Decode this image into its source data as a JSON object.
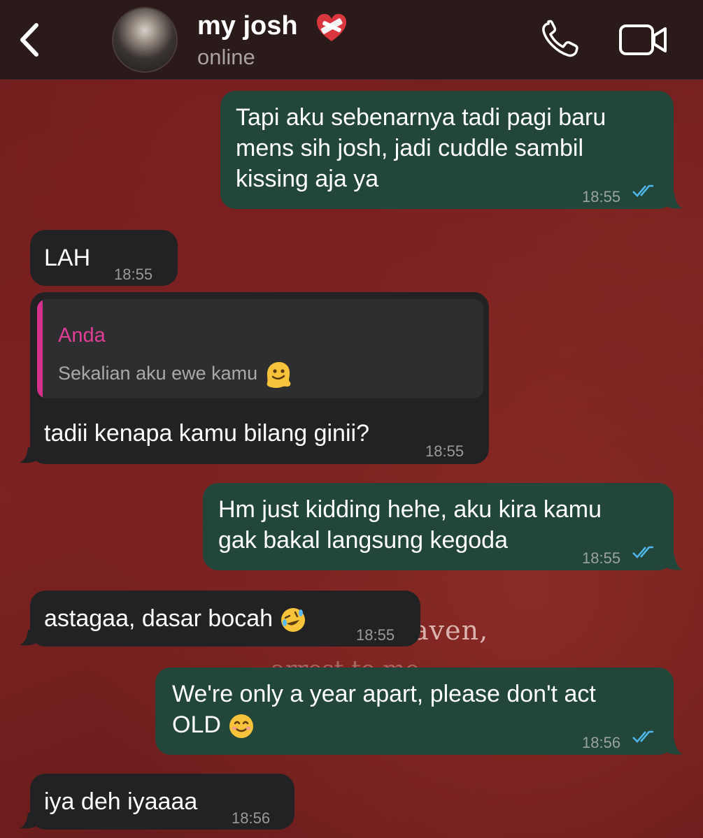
{
  "header": {
    "back_icon": "chevron-left-icon",
    "contact_name": "my josh",
    "name_emoji": "mending-heart-icon",
    "status": "online",
    "call_icon": "phone-icon",
    "video_icon": "video-camera-icon"
  },
  "wallpaper": {
    "text_line1": "aven,",
    "text_line2": "...arrest to me"
  },
  "messages": [
    {
      "direction": "outgoing",
      "lines": [
        "Tapi aku sebenarnya tadi pagi baru",
        "mens sih josh, jadi cuddle sambil",
        "kissing aja ya"
      ],
      "time": "18:55",
      "read": true
    },
    {
      "direction": "incoming",
      "lines": [
        "LAH"
      ],
      "time": "18:55"
    },
    {
      "direction": "incoming",
      "reply": {
        "author": "Anda",
        "text": "Sekalian aku ewe kamu",
        "emoji": "melting-face-icon"
      },
      "lines": [
        "tadii kenapa kamu bilang ginii?"
      ],
      "time": "18:55"
    },
    {
      "direction": "outgoing",
      "lines": [
        "Hm just kidding hehe, aku kira kamu",
        "gak bakal langsung kegoda"
      ],
      "time": "18:55",
      "read": true
    },
    {
      "direction": "incoming",
      "lines": [
        "astagaa, dasar bocah"
      ],
      "emoji": "rofl-face-icon",
      "time": "18:55"
    },
    {
      "direction": "outgoing",
      "lines": [
        "We're only a year apart, please don't act",
        "OLD"
      ],
      "emoji": "smiling-face-icon",
      "time": "18:56",
      "read": true
    },
    {
      "direction": "incoming",
      "lines": [
        "iya deh iyaaaa"
      ],
      "time": "18:56"
    }
  ],
  "colors": {
    "outgoing_bubble": "#22473a",
    "incoming_bubble": "#222224",
    "reply_accent": "#d5308a",
    "read_ticks": "#4fb6ec",
    "header_bg": "#2a1a1a"
  }
}
